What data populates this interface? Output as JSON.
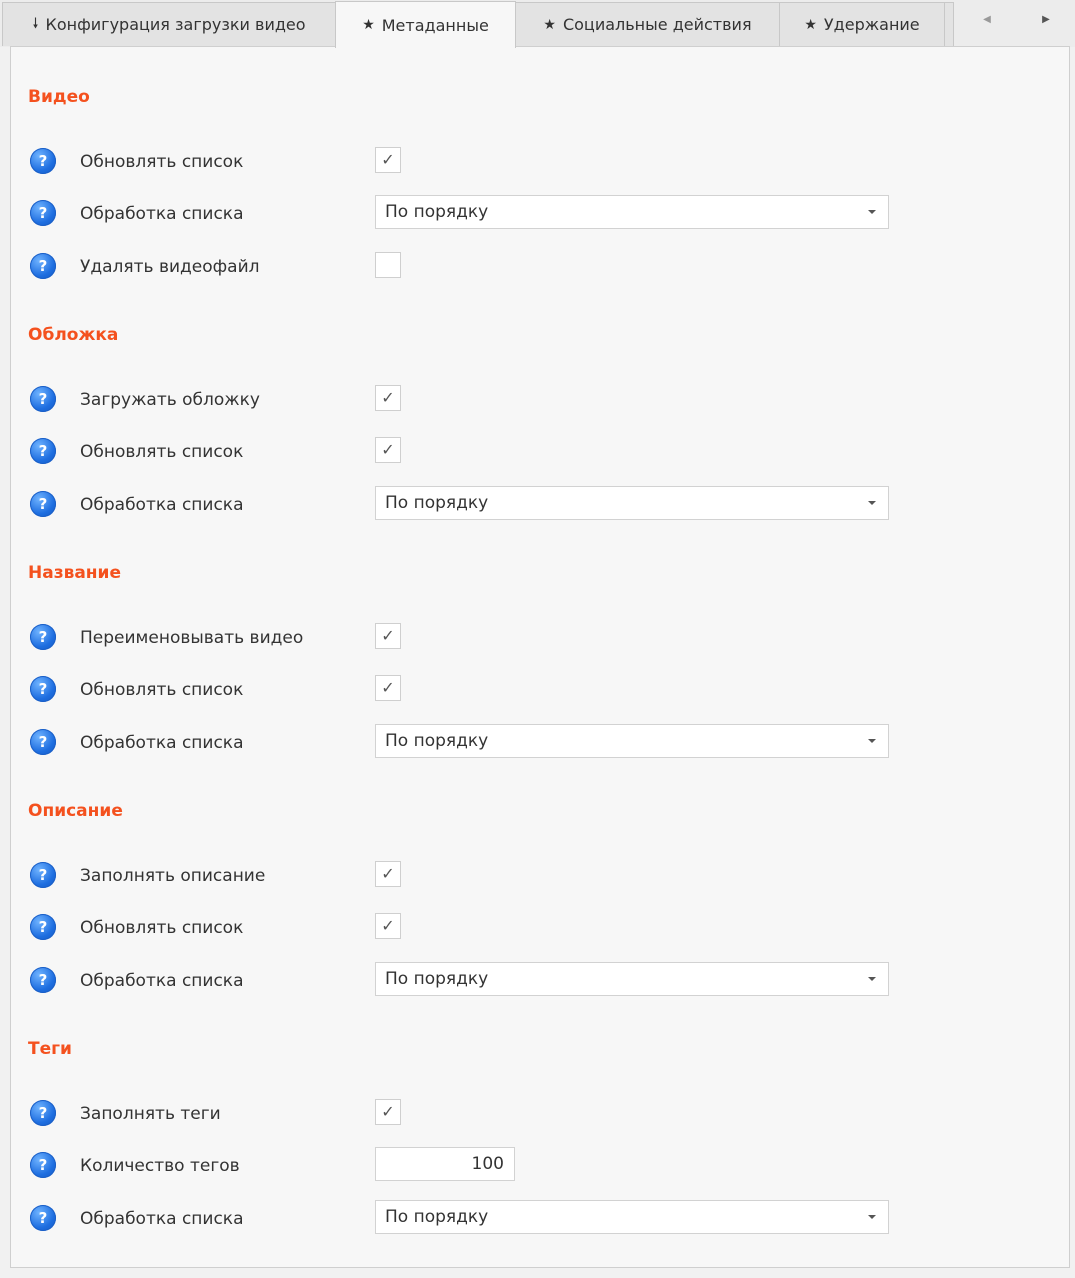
{
  "tabs": [
    {
      "label": "Конфигурация загрузки видео",
      "icon": "download-arrow-icon",
      "glyph": "🠗"
    },
    {
      "label": "Метаданные",
      "icon": "star-icon",
      "glyph": "★"
    },
    {
      "label": "Социальные действия",
      "icon": "star-icon",
      "glyph": "★"
    },
    {
      "label": "Удержание",
      "icon": "star-icon",
      "glyph": "★"
    }
  ],
  "active_tab": "Метаданные",
  "nav": {
    "left_glyph": "◀",
    "right_glyph": "▶"
  },
  "help_glyph": "?",
  "check_glyph": "✓",
  "colors": {
    "section_title": "#f4511e",
    "help_icon": "#1e6ee0"
  },
  "sections": [
    {
      "title": "Видео",
      "rows": [
        {
          "label": "Обновлять список",
          "type": "checkbox",
          "checked": true
        },
        {
          "label": "Обработка списка",
          "type": "select",
          "value": "По порядку"
        },
        {
          "label": "Удалять видеофайл",
          "type": "checkbox",
          "checked": false
        }
      ]
    },
    {
      "title": "Обложка",
      "rows": [
        {
          "label": "Загружать обложку",
          "type": "checkbox",
          "checked": true
        },
        {
          "label": "Обновлять список",
          "type": "checkbox",
          "checked": true
        },
        {
          "label": "Обработка списка",
          "type": "select",
          "value": "По порядку"
        }
      ]
    },
    {
      "title": "Название",
      "rows": [
        {
          "label": "Переименовывать видео",
          "type": "checkbox",
          "checked": true
        },
        {
          "label": "Обновлять список",
          "type": "checkbox",
          "checked": true
        },
        {
          "label": "Обработка списка",
          "type": "select",
          "value": "По порядку"
        }
      ]
    },
    {
      "title": "Описание",
      "rows": [
        {
          "label": "Заполнять описание",
          "type": "checkbox",
          "checked": true
        },
        {
          "label": "Обновлять список",
          "type": "checkbox",
          "checked": true
        },
        {
          "label": "Обработка списка",
          "type": "select",
          "value": "По порядку"
        }
      ]
    },
    {
      "title": "Теги",
      "rows": [
        {
          "label": "Заполнять теги",
          "type": "checkbox",
          "checked": true
        },
        {
          "label": "Количество тегов",
          "type": "number",
          "value": "100"
        },
        {
          "label": "Обработка списка",
          "type": "select",
          "value": "По порядку"
        }
      ]
    }
  ]
}
